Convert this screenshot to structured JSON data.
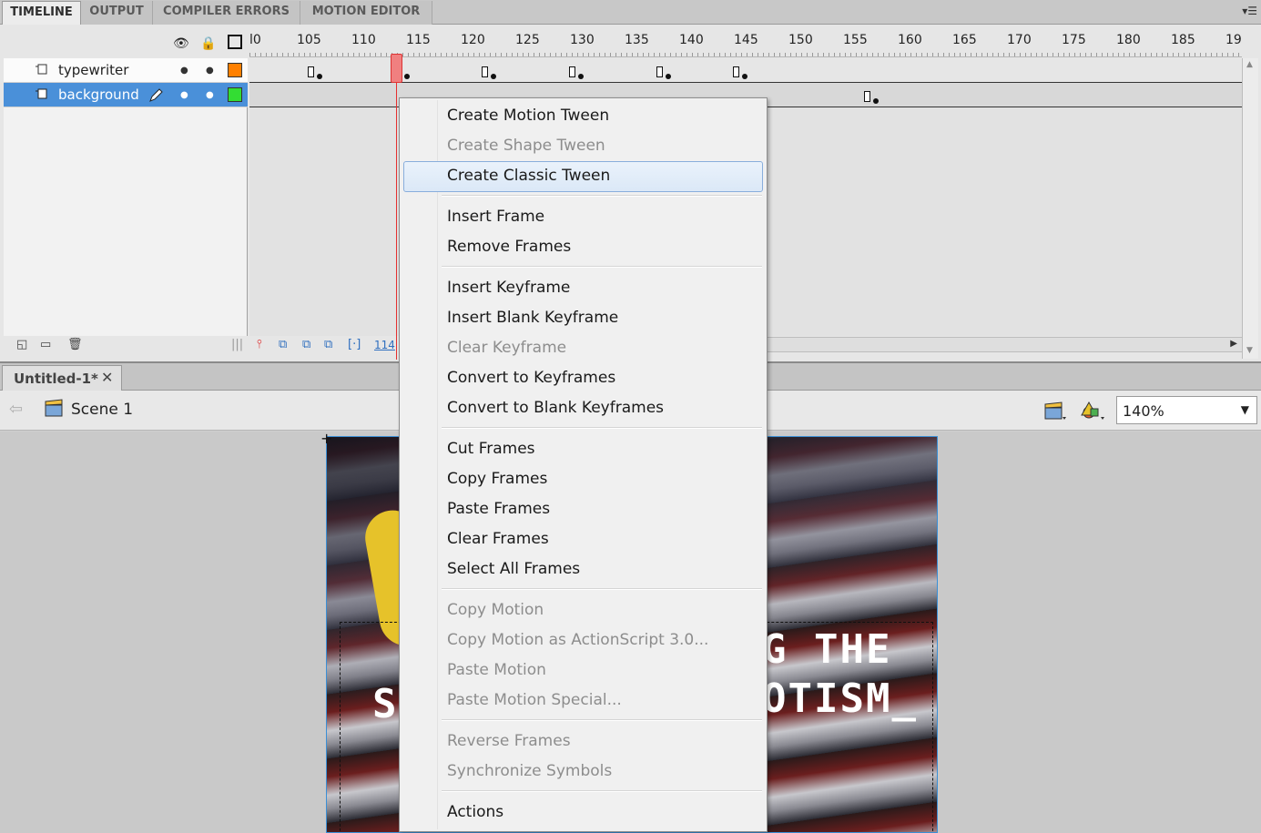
{
  "panel_tabs": [
    "TIMELINE",
    "OUTPUT",
    "COMPILER ERRORS",
    "MOTION EDITOR"
  ],
  "panel_menu_icon": "panel-menu-icon",
  "timeline": {
    "ruler_labels": [
      "l0",
      "105",
      "110",
      "115",
      "120",
      "125",
      "130",
      "135",
      "140",
      "145",
      "150",
      "155",
      "160",
      "165",
      "170",
      "175",
      "180",
      "185",
      "19"
    ],
    "layers": [
      {
        "name": "typewriter",
        "color": "#ff8000",
        "selected": false
      },
      {
        "name": "background",
        "color": "#33dd33",
        "selected": true
      }
    ],
    "current_frame": "114",
    "header_icons": [
      "eye-icon",
      "lock-icon",
      "outline-icon"
    ]
  },
  "document": {
    "tab_label": "Untitled-1*",
    "close_glyph": "✕",
    "scene_label": "Scene 1",
    "zoom": "140%"
  },
  "stage": {
    "text_line_1": "G THE",
    "text_line_2": "OTISM_",
    "text_left": "S"
  },
  "context_menu": {
    "groups": [
      [
        {
          "label": "Create Motion Tween",
          "enabled": true
        },
        {
          "label": "Create Shape Tween",
          "enabled": false
        },
        {
          "label": "Create Classic Tween",
          "enabled": true,
          "highlighted": true
        }
      ],
      [
        {
          "label": "Insert Frame",
          "enabled": true
        },
        {
          "label": "Remove Frames",
          "enabled": true
        }
      ],
      [
        {
          "label": "Insert Keyframe",
          "enabled": true
        },
        {
          "label": "Insert Blank Keyframe",
          "enabled": true
        },
        {
          "label": "Clear Keyframe",
          "enabled": false
        },
        {
          "label": "Convert to Keyframes",
          "enabled": true
        },
        {
          "label": "Convert to Blank Keyframes",
          "enabled": true
        }
      ],
      [
        {
          "label": "Cut Frames",
          "enabled": true
        },
        {
          "label": "Copy Frames",
          "enabled": true
        },
        {
          "label": "Paste Frames",
          "enabled": true
        },
        {
          "label": "Clear Frames",
          "enabled": true
        },
        {
          "label": "Select All Frames",
          "enabled": true
        }
      ],
      [
        {
          "label": "Copy Motion",
          "enabled": false
        },
        {
          "label": "Copy Motion as ActionScript 3.0...",
          "enabled": false
        },
        {
          "label": "Paste Motion",
          "enabled": false
        },
        {
          "label": "Paste Motion Special...",
          "enabled": false
        }
      ],
      [
        {
          "label": "Reverse Frames",
          "enabled": false
        },
        {
          "label": "Synchronize Symbols",
          "enabled": false
        }
      ],
      [
        {
          "label": "Actions",
          "enabled": true
        }
      ]
    ]
  }
}
